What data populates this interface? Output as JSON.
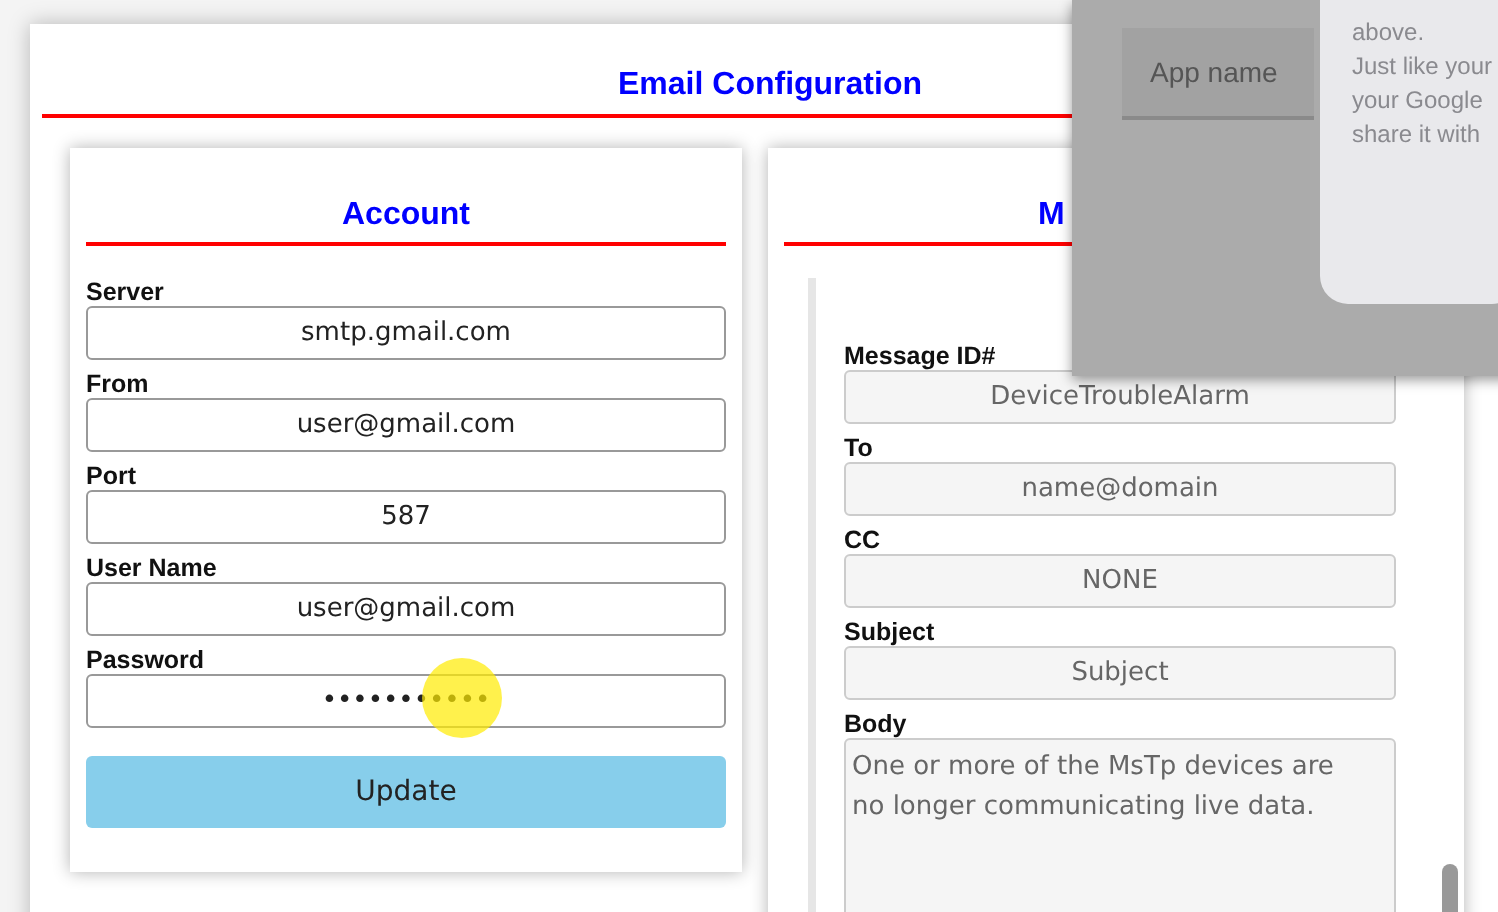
{
  "page": {
    "title": "Email Configuration"
  },
  "account": {
    "title": "Account",
    "fields": [
      {
        "label": "Server",
        "value": "smtp.gmail.com",
        "kind": "text",
        "disabled": false
      },
      {
        "label": "From",
        "value": "user@gmail.com",
        "kind": "text",
        "disabled": false
      },
      {
        "label": "Port",
        "value": "587",
        "kind": "text",
        "disabled": false
      },
      {
        "label": "User Name",
        "value": "user@gmail.com",
        "kind": "text",
        "disabled": false
      },
      {
        "label": "Password",
        "value": "•••••••••••",
        "kind": "password",
        "disabled": false
      }
    ],
    "button": "Update"
  },
  "message": {
    "title": "M",
    "fields": [
      {
        "label": "Message ID#",
        "value": "DeviceTroubleAlarm",
        "kind": "text",
        "disabled": true
      },
      {
        "label": "To",
        "placeholder": "name@domain",
        "kind": "text",
        "disabled": true
      },
      {
        "label": "CC",
        "value": "NONE",
        "kind": "text",
        "disabled": true
      },
      {
        "label": "Subject",
        "placeholder": "Subject",
        "kind": "text",
        "disabled": true
      },
      {
        "label": "Body",
        "value": "One or more of the MsTp devices are no longer communicating live data.",
        "kind": "textarea",
        "disabled": true
      }
    ]
  },
  "dialog": {
    "field_placeholder": "App name",
    "note_lines": [
      "above.",
      "Just like your",
      "your Google",
      "share it with"
    ]
  }
}
